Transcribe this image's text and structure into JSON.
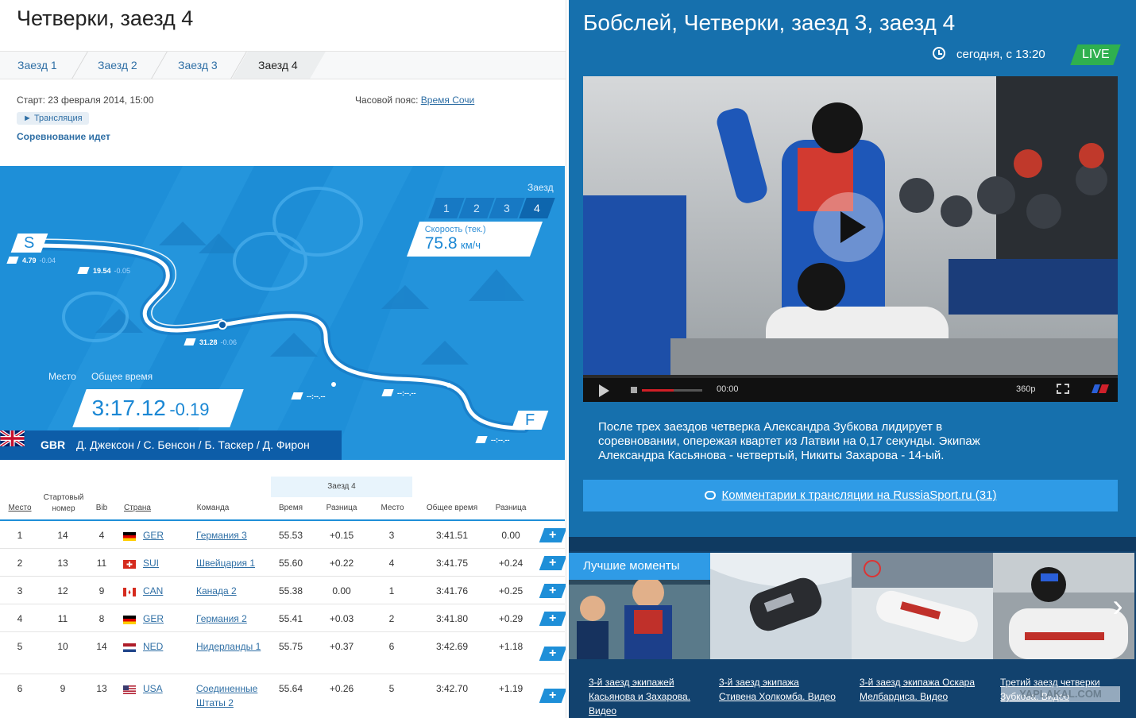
{
  "left": {
    "title": "Четверки, заезд 4",
    "tabs": [
      {
        "label": "Заезд 1"
      },
      {
        "label": "Заезд 2"
      },
      {
        "label": "Заезд 3"
      },
      {
        "label": "Заезд 4"
      }
    ],
    "start": "Старт: 23 февраля 2014, 15:00",
    "timezone_label": "Часовой пояс:",
    "timezone_link": "Время Сочи",
    "stream_button": "► Трансляция",
    "status": "Соревнование идет"
  },
  "track": {
    "run_label": "Заезд",
    "runs": [
      "1",
      "2",
      "3",
      "4"
    ],
    "active_run": "4",
    "speed_label": "Скорость (тек.)",
    "speed_value": "75.8",
    "speed_unit": "км/ч",
    "place_label": "Место",
    "total_label": "Общее время",
    "total_time": "3:17.12",
    "total_diff": "-0.19",
    "start_marker": "S",
    "finish_marker": "F",
    "splits": [
      {
        "time": "4.79",
        "diff": "-0.04"
      },
      {
        "time": "19.54",
        "diff": "-0.05"
      },
      {
        "time": "31.28",
        "diff": "-0.06"
      },
      {
        "time": "--:--.--",
        "diff": ""
      },
      {
        "time": "--:--.--",
        "diff": ""
      },
      {
        "time": "--:--.--",
        "diff": ""
      }
    ],
    "team_code": "GBR",
    "team_names": "Д. Джексон / С. Бенсон / Б. Таскер / Д. Фирон"
  },
  "table": {
    "group_header": "Заезд 4",
    "headers": {
      "place": "Место",
      "start_no": "Стартовый номер",
      "bib": "Bib",
      "country": "Страна",
      "team": "Команда",
      "time": "Время",
      "diff": "Разница",
      "run_place": "Место",
      "total": "Общее время",
      "total_diff": "Разница"
    },
    "rows": [
      {
        "place": "1",
        "start": "14",
        "bib": "4",
        "country": "GER",
        "team": "Германия 3",
        "time": "55.53",
        "diff": "+0.15",
        "run_place": "3",
        "total": "3:41.51",
        "total_diff": "0.00"
      },
      {
        "place": "2",
        "start": "13",
        "bib": "11",
        "country": "SUI",
        "team": "Швейцария 1",
        "time": "55.60",
        "diff": "+0.22",
        "run_place": "4",
        "total": "3:41.75",
        "total_diff": "+0.24"
      },
      {
        "place": "3",
        "start": "12",
        "bib": "9",
        "country": "CAN",
        "team": "Канада 2",
        "time": "55.38",
        "diff": "0.00",
        "run_place": "1",
        "total": "3:41.76",
        "total_diff": "+0.25"
      },
      {
        "place": "4",
        "start": "11",
        "bib": "8",
        "country": "GER",
        "team": "Германия 2",
        "time": "55.41",
        "diff": "+0.03",
        "run_place": "2",
        "total": "3:41.80",
        "total_diff": "+0.29"
      },
      {
        "place": "5",
        "start": "10",
        "bib": "14",
        "country": "NED",
        "team": "Нидерланды 1",
        "time": "55.75",
        "diff": "+0.37",
        "run_place": "6",
        "total": "3:42.69",
        "total_diff": "+1.18"
      },
      {
        "place": "6",
        "start": "9",
        "bib": "13",
        "country": "USA",
        "team": "Соединенные Штаты 2",
        "time": "55.64",
        "diff": "+0.26",
        "run_place": "5",
        "total": "3:42.70",
        "total_diff": "+1.19"
      }
    ],
    "expand_label": "+"
  },
  "right": {
    "title": "Бобслей, Четверки, заезд 3, заезд 4",
    "when": "сегодня, с 13:20",
    "live": "LIVE",
    "player": {
      "time": "00:00",
      "quality": "360p"
    },
    "description": "После трех заездов четверка Александра Зубкова лидирует в соревновании, опережая квартет из Латвии на 0,17 секунды. Экипаж Александра Касьянова - четвертый, Никиты Захарова - 14-ый.",
    "comments_link": "Комментарии к трансляции на RussiaSport.ru (31)",
    "highlights_title": "Лучшие моменты",
    "highlights_next": "›",
    "highlights": [
      "3-й заезд экипажей Касьянова и Захарова. Видео",
      "3-й заезд экипажа Стивена Холкомба. Видео",
      "3-й заезд экипажа Оскара Мелбардиса. Видео",
      "Третий заезд четверки Зубкова. Видео"
    ],
    "watermark": "YAPLAKAL.COM"
  },
  "colors": {
    "accent": "#1e8fd8",
    "panel": "#1670ad",
    "live": "#2fb04f",
    "link": "#2f6fa5"
  }
}
